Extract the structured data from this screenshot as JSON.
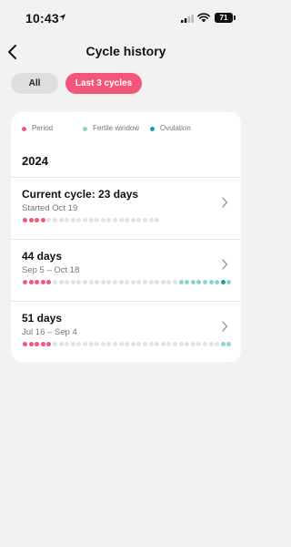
{
  "status_bar": {
    "time": "10:43",
    "battery": "71"
  },
  "header": {
    "title": "Cycle history"
  },
  "filters": [
    {
      "label": "All",
      "selected": false
    },
    {
      "label": "Last 3 cycles",
      "selected": true
    }
  ],
  "legend": [
    {
      "label": "Period",
      "color": "#f2577a"
    },
    {
      "label": "Fertile window",
      "color": "#8fd3d3"
    },
    {
      "label": "Ovulation",
      "color": "#1f9b9b"
    }
  ],
  "year": "2024",
  "colors": {
    "period": "#f2577a",
    "fertile": "#8fd3d3",
    "ovulation": "#1f9b9b",
    "empty": "#e2e2e2"
  },
  "cycles": [
    {
      "title": "Current cycle: 23 days",
      "subtitle": "Started Oct 19",
      "dots": [
        "p",
        "p",
        "p",
        "p",
        "e",
        "e",
        "e",
        "e",
        "e",
        "e",
        "e",
        "e",
        "e",
        "e",
        "e",
        "e",
        "e",
        "e",
        "e",
        "e",
        "e",
        "e",
        "e"
      ]
    },
    {
      "title": "44 days",
      "subtitle": "Sep 5 – Oct 18",
      "dots": [
        "p",
        "p",
        "p",
        "p",
        "p",
        "e",
        "e",
        "e",
        "e",
        "e",
        "e",
        "e",
        "e",
        "e",
        "e",
        "e",
        "e",
        "e",
        "e",
        "e",
        "e",
        "e",
        "e",
        "e",
        "e",
        "e",
        "f",
        "f",
        "f",
        "f",
        "f",
        "f",
        "f",
        "o",
        "f"
      ]
    },
    {
      "title": "51 days",
      "subtitle": "Jul 16 – Sep 4",
      "dots": [
        "p",
        "p",
        "p",
        "p",
        "p",
        "e",
        "e",
        "e",
        "e",
        "e",
        "e",
        "e",
        "e",
        "e",
        "e",
        "e",
        "e",
        "e",
        "e",
        "e",
        "e",
        "e",
        "e",
        "e",
        "e",
        "e",
        "e",
        "e",
        "e",
        "e",
        "e",
        "e",
        "e",
        "f",
        "f"
      ]
    }
  ]
}
